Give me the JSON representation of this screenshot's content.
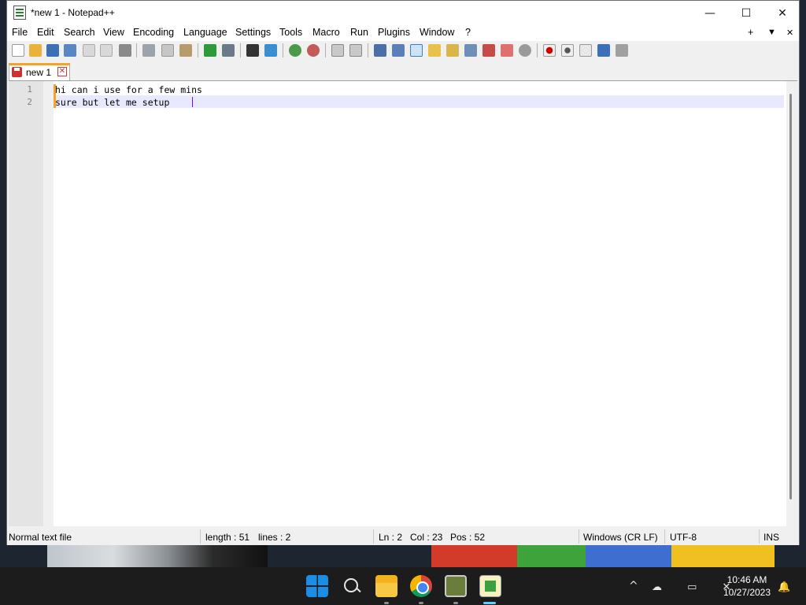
{
  "window": {
    "title": "*new 1 - Notepad++",
    "controls": {
      "minimize": "—",
      "maximize": "☐",
      "close": "✕"
    }
  },
  "menu": {
    "items": [
      "File",
      "Edit",
      "Search",
      "View",
      "Encoding",
      "Language",
      "Settings",
      "Tools",
      "Macro",
      "Run",
      "Plugins",
      "Window",
      "?"
    ],
    "right": {
      "add": "+",
      "dropdown": "▼",
      "close": "✕"
    }
  },
  "toolbar": {
    "icons": [
      "new-file",
      "open-file",
      "save",
      "save-all",
      "close",
      "close-all",
      "print",
      "cut",
      "copy",
      "paste",
      "undo",
      "redo",
      "find",
      "replace",
      "zoom-in",
      "zoom-out",
      "sync-vertical",
      "sync-horizontal",
      "word-wrap",
      "show-all-characters",
      "indent-guide",
      "udl",
      "doc-map",
      "function-list",
      "folder-as-workspace",
      "monitoring",
      "record-macro",
      "stop-macro",
      "play-macro",
      "run-macro-multiple",
      "save-macro"
    ]
  },
  "tabs": [
    {
      "label": "new 1",
      "close": "✕",
      "modified": true
    }
  ],
  "editor": {
    "lines": [
      {
        "number": "1",
        "text": "hi can i use for a few mins"
      },
      {
        "number": "2",
        "text": "sure but let me setup "
      }
    ],
    "current_line": 2
  },
  "status": {
    "file_type": "Normal text file",
    "length": "length : 51",
    "lines": "lines : 2",
    "ln": "Ln : 2",
    "col": "Col : 23",
    "pos": "Pos : 52",
    "eol": "Windows (CR LF)",
    "encoding": "UTF-8",
    "mode": "INS"
  },
  "taskbar": {
    "apps": [
      "start",
      "search",
      "file-explorer",
      "chrome",
      "app",
      "notepad-plus-plus"
    ],
    "active_app": "notepad-plus-plus",
    "tray_chevron": "^",
    "tray_icons": "☁ ▭ ✕",
    "bell": "🔔",
    "time": "10:46 AM",
    "date": "10/27/2023"
  },
  "colors": {
    "accent": "#f6a323",
    "current_line": "#e8e8ff",
    "caret": "#8000ff",
    "taskbar": "#1c1c1c"
  }
}
